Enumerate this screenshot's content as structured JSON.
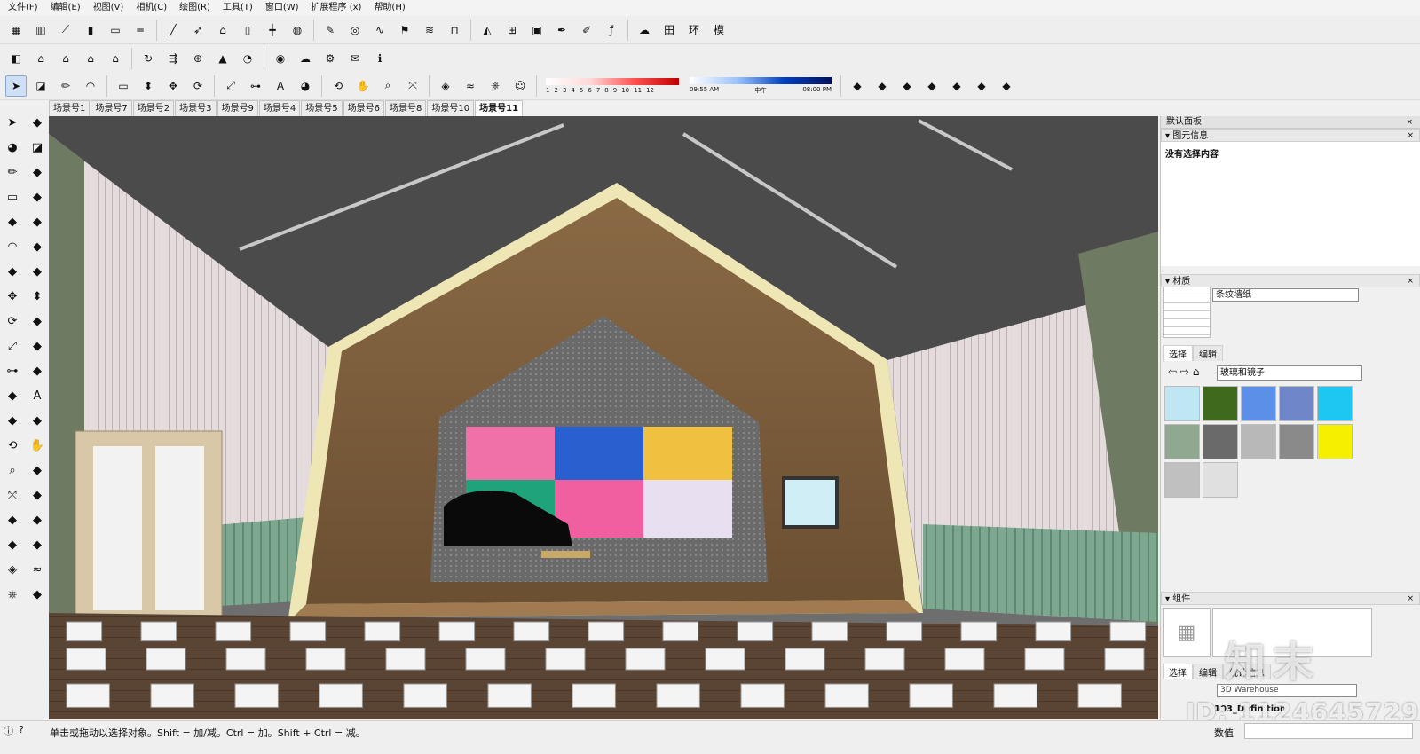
{
  "menu": [
    "文件(F)",
    "编辑(E)",
    "视图(V)",
    "相机(C)",
    "绘图(R)",
    "工具(T)",
    "窗口(W)",
    "扩展程序 (x)",
    "帮助(H)"
  ],
  "icons": {
    "row1": [
      "wall-icon",
      "column-icon",
      "stair-icon",
      "bar-icon",
      "slab-icon",
      "beam-icon",
      "line-icon",
      "arrow-icon",
      "roof-icon",
      "door-icon",
      "railing-icon",
      "cylinder-icon",
      "paint-icon",
      "spiral-icon",
      "tube-icon",
      "flag-icon",
      "wave-icon",
      "gate-icon",
      "triangle-icon",
      "grid-icon",
      "window-icon",
      "pen-icon",
      "brush-icon"
    ],
    "row1_right": [
      "fx-icon",
      "cloud-icon",
      "tian-icon",
      "huan-icon",
      "mo-icon"
    ],
    "row2": [
      "box-icon",
      "house-icon",
      "house2-icon",
      "house3-icon",
      "house4-icon",
      "refresh-icon",
      "export-icon",
      "plus-icon",
      "tree-icon",
      "shading-icon",
      "ball-icon",
      "upload-icon",
      "settings-icon",
      "mail-icon",
      "info-icon"
    ],
    "row3": [
      "select-icon",
      "eraser-icon",
      "pencil-icon",
      "arc-icon",
      "rectangle-icon",
      "pushpull-icon",
      "move-icon",
      "rotate-icon",
      "scale-icon",
      "tape-icon",
      "text-icon",
      "paint-bucket-icon",
      "orbit-icon",
      "pan-icon",
      "zoom-icon",
      "zoom-extents-icon",
      "solid-icon",
      "sandbox-icon",
      "stamp-icon",
      "user-icon"
    ]
  },
  "shadow": {
    "scale_labels": [
      "1",
      "2",
      "3",
      "4",
      "5",
      "6",
      "7",
      "8",
      "9",
      "10",
      "11",
      "12"
    ],
    "time_start": "09:55 AM",
    "time_mid": "中午",
    "time_end": "08:00 PM"
  },
  "tabs": [
    "场景号1",
    "场景号7",
    "场景号2",
    "场景号3",
    "场景号9",
    "场景号4",
    "场景号5",
    "场景号6",
    "场景号8",
    "场景号10",
    "场景号11"
  ],
  "active_tab": "场景号11",
  "tray": {
    "title": "默认面板",
    "entity_title": "图元信息",
    "entity_text": "没有选择内容",
    "material_title": "材质",
    "material_name": "条纹墙纸",
    "select_tab": "选择",
    "edit_tab": "编辑",
    "library": "玻璃和镜子",
    "swatch_colors": [
      "#bfe6f3",
      "#3f6a1d",
      "#5b8fe8",
      "#6f86c9",
      "#1ec6f2",
      "#8fa88f",
      "#6a6a6a",
      "#b8b8b8",
      "#8a8a8a",
      "#f4f000",
      "#c0c0c0",
      "#e0e0e0"
    ],
    "component_title": "组件",
    "comp_select": "选择",
    "comp_edit": "编辑",
    "comp_stats": "统计信息",
    "warehouse": "3D Warehouse",
    "component_item": "103_Definition"
  },
  "status": {
    "text": "单击或拖动以选择对象。Shift = 加/减。Ctrl = 加。Shift + Ctrl = 减。",
    "measure_label": "数值"
  },
  "watermark": {
    "logo": "知末",
    "id": "ID: 1124645729"
  }
}
